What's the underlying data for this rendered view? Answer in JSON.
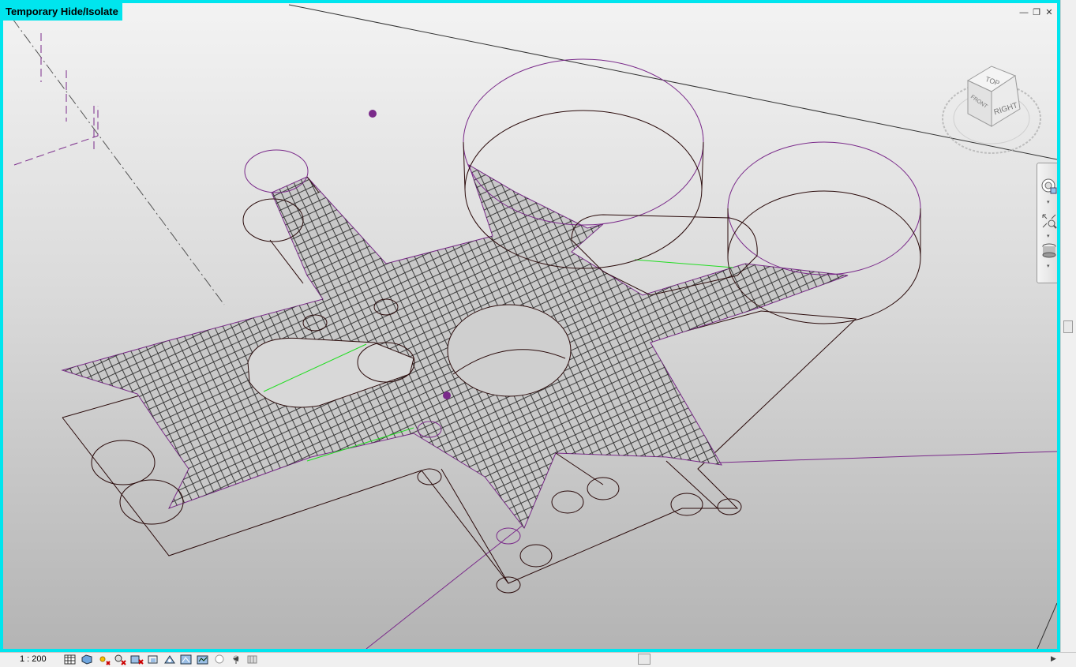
{
  "view": {
    "title": "Temporary Hide/Isolate",
    "controls": {
      "minimize": "—",
      "restore": "❐",
      "close": "✕"
    }
  },
  "viewcube": {
    "top": "TOP",
    "front": "FRONT",
    "right": "RIGHT"
  },
  "navbar": {
    "items": [
      "steering-wheel",
      "zoom",
      "orbit"
    ]
  },
  "statusbar": {
    "scale": "1 : 200",
    "icons": [
      "detail-level",
      "visual-style",
      "sun-path",
      "shadows",
      "crop-view",
      "show-crop",
      "temporary-hide",
      "reveal-hidden",
      "analysis",
      "highlight",
      "lightbulb",
      "worksharing"
    ]
  },
  "colors": {
    "highlight": "#00e5ee",
    "edge": "#2a0a0a",
    "selection": "#7a2a8a",
    "green": "#22dd22"
  }
}
